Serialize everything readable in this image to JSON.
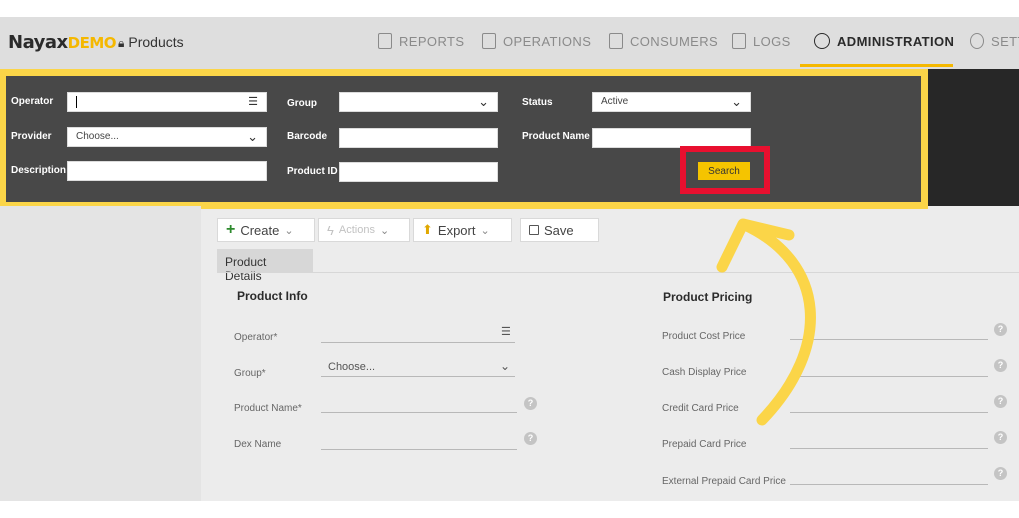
{
  "brand": {
    "name": "Nayax",
    "suffix": "DEMO"
  },
  "page": {
    "title": "Products"
  },
  "nav": [
    {
      "label": "REPORTS",
      "active": false
    },
    {
      "label": "OPERATIONS",
      "active": false
    },
    {
      "label": "CONSUMERS",
      "active": false
    },
    {
      "label": "LOGS",
      "active": false
    },
    {
      "label": "ADMINISTRATION",
      "active": true
    },
    {
      "label": "SETT",
      "active": false
    }
  ],
  "filters": {
    "operator_label": "Operator",
    "operator_value": "",
    "provider_label": "Provider",
    "provider_value": "Choose...",
    "description_label": "Description",
    "description_value": "",
    "group_label": "Group",
    "group_value": "",
    "barcode_label": "Barcode",
    "barcode_value": "",
    "product_id_label": "Product ID",
    "product_id_value": "",
    "status_label": "Status",
    "status_value": "Active",
    "product_name_label": "Product Name",
    "product_name_value": "",
    "search_label": "Search"
  },
  "toolbar": {
    "create_label": "Create",
    "actions_label": "Actions",
    "export_label": "Export",
    "save_label": "Save"
  },
  "tabs": [
    {
      "label": "Product Details"
    }
  ],
  "product_info": {
    "title": "Product Info",
    "operator_label": "Operator*",
    "group_label": "Group*",
    "group_value": "Choose...",
    "product_name_label": "Product Name*",
    "dex_name_label": "Dex Name"
  },
  "product_pricing": {
    "title": "Product Pricing",
    "fields": [
      {
        "label": "Product Cost Price"
      },
      {
        "label": "Cash Display Price"
      },
      {
        "label": "Credit Card Price"
      },
      {
        "label": "Prepaid Card Price"
      },
      {
        "label": "External Prepaid Card Price"
      }
    ]
  },
  "colors": {
    "accent": "#f5b800",
    "filter_bg": "#484848",
    "highlight_yellow": "#fbd548",
    "highlight_red": "#e8102f"
  },
  "icons": {
    "operator_list": "list-icon",
    "help": "question-icon",
    "callout_arrow": "curved-arrow-icon"
  }
}
